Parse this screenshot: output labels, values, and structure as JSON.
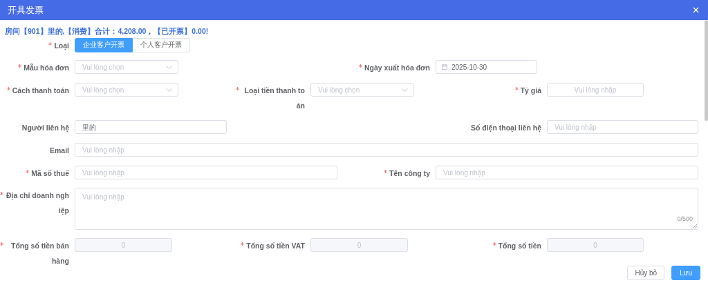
{
  "dialog": {
    "title": "开具发票"
  },
  "summary": "房间【901】里的,【消费】合计：4,208.00，【已开票】0.00!",
  "fields": [
    {
      "kind": "segmented",
      "label": "Loại",
      "required": true,
      "options": [
        {
          "label": "企业客户开票",
          "selected": true
        },
        {
          "label": "个人客户开票",
          "selected": false
        }
      ]
    },
    {
      "kind": "select",
      "label": "Mẫu hóa đơn",
      "required": true,
      "placeholder": "Vui lòng chọn"
    },
    {
      "kind": "date",
      "label": "Ngày xuất hóa đơn",
      "required": true,
      "value": "2025-10-30"
    },
    {
      "kind": "select",
      "label": "Cách thanh toán",
      "required": true,
      "placeholder": "Vui lòng chọn"
    },
    {
      "kind": "select",
      "label": "Loại tiền thanh toán",
      "required": true,
      "placeholder": "Vui lòng chọn"
    },
    {
      "kind": "number",
      "label": "Tỷ giá",
      "required": true,
      "placeholder": "Vui lòng nhập"
    },
    {
      "kind": "text",
      "label": "Người liên hệ",
      "required": false,
      "value": "里的"
    },
    {
      "kind": "text",
      "label": "Số điện thoại liên hệ",
      "required": false,
      "placeholder": "Vui lòng nhập"
    },
    {
      "kind": "text",
      "label": "Email",
      "required": false,
      "placeholder": "Vui lòng nhập"
    },
    {
      "kind": "text",
      "label": "Mã số thuế",
      "required": true,
      "placeholder": "Vui lòng nhập"
    },
    {
      "kind": "text",
      "label": "Tên công ty",
      "required": true,
      "placeholder": "Vui lòng nhập"
    },
    {
      "kind": "textarea",
      "label": "Địa chỉ doanh nghiệp",
      "required": true,
      "placeholder": "Vui lòng nhập",
      "counter": "0/500"
    },
    {
      "kind": "number",
      "label": "Tổng số tiền bán hàng",
      "required": true,
      "value": "0",
      "disabled": true
    },
    {
      "kind": "number",
      "label": "Tổng số tiền VAT",
      "required": true,
      "value": "0",
      "disabled": true
    },
    {
      "kind": "number",
      "label": "Tổng số tiền",
      "required": true,
      "value": "0",
      "disabled": true
    }
  ],
  "buttons": [
    {
      "label": "Hủy bỏ",
      "primary": false
    },
    {
      "label": "Lưu",
      "primary": true
    }
  ]
}
